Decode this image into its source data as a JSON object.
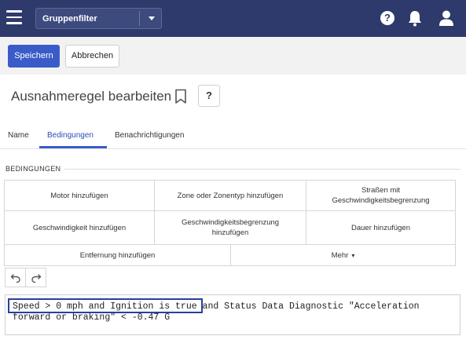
{
  "header": {
    "group_filter_label": "Gruppenfilter",
    "help_glyph": "?",
    "icons": [
      "menu-icon",
      "chevron-down-icon",
      "help-icon",
      "bell-icon",
      "user-icon"
    ]
  },
  "toolbar": {
    "save_label": "Speichern",
    "cancel_label": "Abbrechen"
  },
  "page": {
    "title": "Ausnahmeregel bearbeiten",
    "help_button_label": "?"
  },
  "tabs": [
    {
      "label": "Name",
      "active": false
    },
    {
      "label": "Bedingungen",
      "active": true
    },
    {
      "label": "Benachrichtigungen",
      "active": false
    }
  ],
  "conditions": {
    "section_label": "BEDINGUNGEN",
    "buttons": {
      "motor": "Motor hinzufügen",
      "zone": "Zone oder Zonentyp hinzufügen",
      "roads": "Straßen mit Geschwindigkeitsbegrenzung",
      "speed": "Geschwindigkeit hinzufügen",
      "speed_limit": "Geschwindigkeitsbegrenzung hinzufügen",
      "duration": "Dauer hinzufügen",
      "distance": "Entfernung hinzufügen",
      "more": "Mehr",
      "more_caret": "▾"
    }
  },
  "expression": {
    "line1": "Speed > 0 mph and Ignition is true and Status Data Diagnostic \"Acceleration",
    "line2": "forward or braking\" < -0.47 G",
    "highlighted_text": "Speed > 0 mph and Ignition is true"
  },
  "colors": {
    "header_bg": "#2e3a6b",
    "primary": "#3a5cc8",
    "highlight_border": "#2a3fa0"
  }
}
